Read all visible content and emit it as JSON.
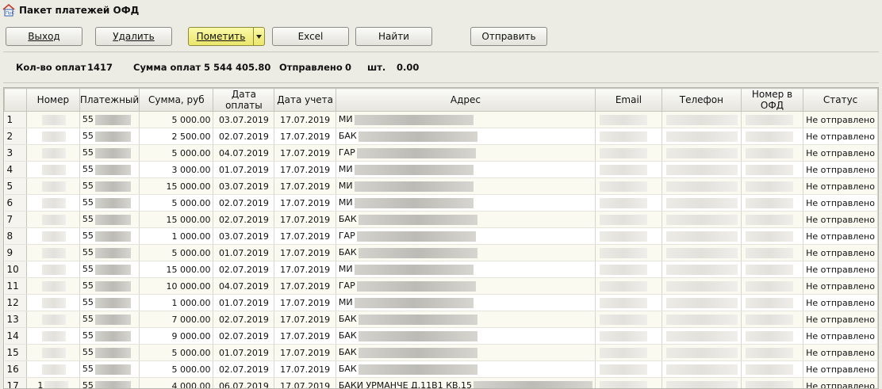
{
  "window": {
    "title": "Пакет платежей ОФД",
    "icon": "app-house-icon"
  },
  "toolbar": {
    "exit_label": "Выход",
    "delete_label": "Удалить",
    "mark_label": "Пометить",
    "excel_label": "Excel",
    "find_label": "Найти",
    "send_label": "Отправить"
  },
  "stats": {
    "count_label": "Кол-во оплат",
    "count_value": "1417",
    "sum_label": "Сумма оплат",
    "sum_value": "5 544 405.80",
    "sent_label": "Отправлено",
    "sent_value": "0",
    "unit": "шт.",
    "sent_sum": "0.00"
  },
  "table": {
    "columns": [
      "",
      "Номер",
      "Платежный",
      "Сумма, руб",
      "Дата оплаты",
      "Дата учета",
      "Адрес",
      "Email",
      "Телефон",
      "Номер в ОФД",
      "Статус"
    ],
    "rows": [
      {
        "n": "1",
        "num": "",
        "pay": "55",
        "sum": "5 000.00",
        "date": "03.07.2019",
        "acc": "17.07.2019",
        "addr": "МИ",
        "status": "Не отправлено"
      },
      {
        "n": "2",
        "num": "",
        "pay": "55",
        "sum": "2 500.00",
        "date": "02.07.2019",
        "acc": "17.07.2019",
        "addr": "БАК",
        "status": "Не отправлено"
      },
      {
        "n": "3",
        "num": "",
        "pay": "55",
        "sum": "5 000.00",
        "date": "04.07.2019",
        "acc": "17.07.2019",
        "addr": "ГАР",
        "status": "Не отправлено"
      },
      {
        "n": "4",
        "num": "",
        "pay": "55",
        "sum": "3 000.00",
        "date": "01.07.2019",
        "acc": "17.07.2019",
        "addr": "МИ",
        "status": "Не отправлено"
      },
      {
        "n": "5",
        "num": "",
        "pay": "55",
        "sum": "15 000.00",
        "date": "03.07.2019",
        "acc": "17.07.2019",
        "addr": "МИ",
        "status": "Не отправлено"
      },
      {
        "n": "6",
        "num": "",
        "pay": "55",
        "sum": "5 000.00",
        "date": "02.07.2019",
        "acc": "17.07.2019",
        "addr": "МИ",
        "status": "Не отправлено"
      },
      {
        "n": "7",
        "num": "",
        "pay": "55",
        "sum": "15 000.00",
        "date": "02.07.2019",
        "acc": "17.07.2019",
        "addr": "БАК",
        "status": "Не отправлено"
      },
      {
        "n": "8",
        "num": "",
        "pay": "55",
        "sum": "1 000.00",
        "date": "03.07.2019",
        "acc": "17.07.2019",
        "addr": "ГАР",
        "status": "Не отправлено"
      },
      {
        "n": "9",
        "num": "",
        "pay": "55",
        "sum": "5 000.00",
        "date": "01.07.2019",
        "acc": "17.07.2019",
        "addr": "БАК",
        "status": "Не отправлено"
      },
      {
        "n": "10",
        "num": "",
        "pay": "55",
        "sum": "15 000.00",
        "date": "02.07.2019",
        "acc": "17.07.2019",
        "addr": "МИ",
        "status": "Не отправлено"
      },
      {
        "n": "11",
        "num": "",
        "pay": "55",
        "sum": "10 000.00",
        "date": "04.07.2019",
        "acc": "17.07.2019",
        "addr": "ГАР",
        "status": "Не отправлено"
      },
      {
        "n": "12",
        "num": "",
        "pay": "55",
        "sum": "1 000.00",
        "date": "01.07.2019",
        "acc": "17.07.2019",
        "addr": "МИ",
        "status": "Не отправлено"
      },
      {
        "n": "13",
        "num": "",
        "pay": "55",
        "sum": "7 000.00",
        "date": "02.07.2019",
        "acc": "17.07.2019",
        "addr": "БАК",
        "status": "Не отправлено"
      },
      {
        "n": "14",
        "num": "",
        "pay": "55",
        "sum": "9 000.00",
        "date": "02.07.2019",
        "acc": "17.07.2019",
        "addr": "БАК",
        "status": "Не отправлено"
      },
      {
        "n": "15",
        "num": "",
        "pay": "55",
        "sum": "5 000.00",
        "date": "01.07.2019",
        "acc": "17.07.2019",
        "addr": "БАК",
        "status": "Не отправлено"
      },
      {
        "n": "16",
        "num": "",
        "pay": "55",
        "sum": "5 000.00",
        "date": "02.07.2019",
        "acc": "17.07.2019",
        "addr": "БАК",
        "status": "Не отправлено"
      },
      {
        "n": "17",
        "num": "1",
        "pay": "55",
        "sum": "4 000.00",
        "date": "06.07.2019",
        "acc": "17.07.2019",
        "addr": "БАКИ УРМАНЧЕ Д.11В1 КВ.15",
        "status": "Не отправлено"
      }
    ]
  }
}
